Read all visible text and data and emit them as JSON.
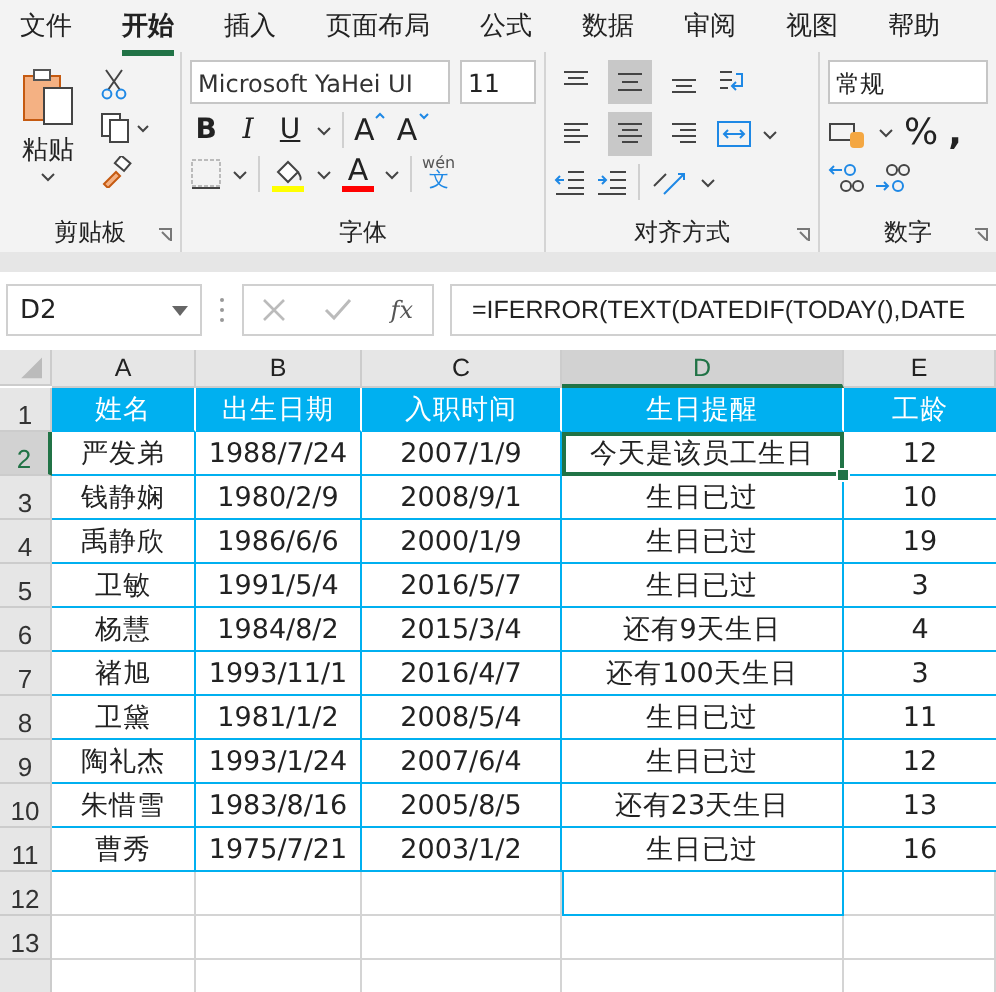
{
  "menu_tabs": [
    {
      "label": "文件",
      "selected": false
    },
    {
      "label": "开始",
      "selected": true
    },
    {
      "label": "插入",
      "selected": false
    },
    {
      "label": "页面布局",
      "selected": false
    },
    {
      "label": "公式",
      "selected": false
    },
    {
      "label": "数据",
      "selected": false
    },
    {
      "label": "审阅",
      "selected": false
    },
    {
      "label": "视图",
      "selected": false
    },
    {
      "label": "帮助",
      "selected": false
    }
  ],
  "ribbon": {
    "clipboard": {
      "paste_label": "粘贴",
      "label": "剪贴板"
    },
    "font": {
      "font_name": "Microsoft YaHei UI",
      "font_size": "11",
      "style_buttons": [
        "B",
        "I",
        "U"
      ],
      "grow_letter": "A",
      "shrink_letter": "A",
      "color_letter": "A",
      "phonetic": {
        "pinyin": "wén",
        "char": "文"
      },
      "label": "字体"
    },
    "alignment": {
      "label": "对齐方式",
      "vertical_buttons": [
        {
          "selected": false
        },
        {
          "selected": true
        },
        {
          "selected": false
        }
      ],
      "horizontal_buttons": [
        {
          "selected": false
        },
        {
          "selected": true
        },
        {
          "selected": false
        }
      ]
    },
    "number": {
      "format": "常规",
      "percent": "%",
      "comma": ",",
      "label": "数字"
    }
  },
  "formula_bar": {
    "name_box": "D2",
    "function_label": "fx",
    "formula": "=IFERROR(TEXT(DATEDIF(TODAY(),DATE"
  },
  "columns": [
    {
      "label": "A",
      "selected": false
    },
    {
      "label": "B",
      "selected": false
    },
    {
      "label": "C",
      "selected": false
    },
    {
      "label": "D",
      "selected": true
    },
    {
      "label": "E",
      "selected": false
    }
  ],
  "row_numbers": [
    {
      "label": "1",
      "selected": false
    },
    {
      "label": "2",
      "selected": true
    },
    {
      "label": "3",
      "selected": false
    },
    {
      "label": "4",
      "selected": false
    },
    {
      "label": "5",
      "selected": false
    },
    {
      "label": "6",
      "selected": false
    },
    {
      "label": "7",
      "selected": false
    },
    {
      "label": "8",
      "selected": false
    },
    {
      "label": "9",
      "selected": false
    },
    {
      "label": "10",
      "selected": false
    },
    {
      "label": "11",
      "selected": false
    },
    {
      "label": "12",
      "selected": false
    },
    {
      "label": "13",
      "selected": false
    }
  ],
  "header_row": [
    "姓名",
    "出生日期",
    "入职时间",
    "生日提醒",
    "工龄"
  ],
  "active_cell": {
    "selected": true
  },
  "rows": [
    [
      "严发弟",
      "1988/7/24",
      "2007/1/9",
      "今天是该员工生日",
      "12"
    ],
    [
      "钱静娴",
      "1980/2/9",
      "2008/9/1",
      "生日已过",
      "10"
    ],
    [
      "禹静欣",
      "1986/6/6",
      "2000/1/9",
      "生日已过",
      "19"
    ],
    [
      "卫敏",
      "1991/5/4",
      "2016/5/7",
      "生日已过",
      "3"
    ],
    [
      "杨慧",
      "1984/8/2",
      "2015/3/4",
      "还有9天生日",
      "4"
    ],
    [
      "褚旭",
      "1993/11/1",
      "2016/4/7",
      "还有100天生日",
      "3"
    ],
    [
      "卫黛",
      "1981/1/2",
      "2008/5/4",
      "生日已过",
      "11"
    ],
    [
      "陶礼杰",
      "1993/1/24",
      "2007/6/4",
      "生日已过",
      "12"
    ],
    [
      "朱惜雪",
      "1983/8/16",
      "2005/8/5",
      "还有23天生日",
      "13"
    ],
    [
      "曹秀",
      "1975/7/21",
      "2003/1/2",
      "生日已过",
      "16"
    ]
  ]
}
